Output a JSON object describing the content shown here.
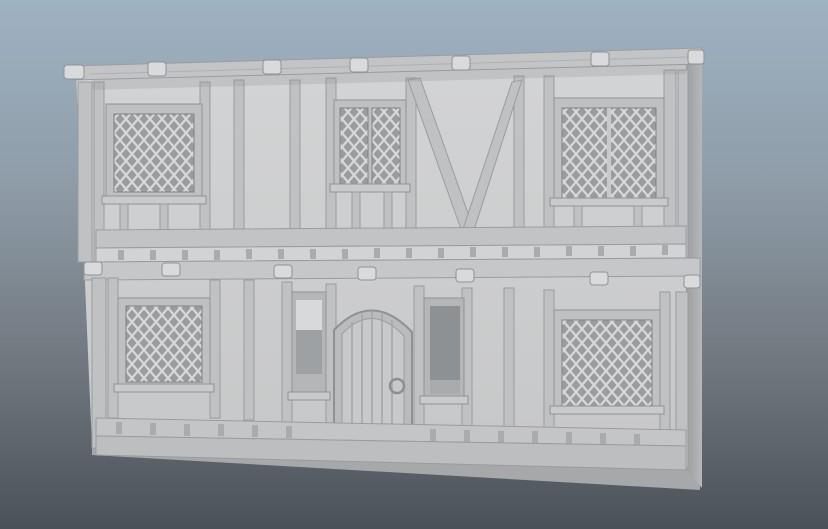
{
  "scene": {
    "subject": "",
    "colors": {
      "background_top": "#9fb2c2",
      "background_bottom": "#4b5158",
      "wall": "#cfd0d1",
      "timber": "#c2c3c4",
      "timber_dark": "#a9abad",
      "shadow": "#8e9194",
      "lattice_back": "#9a9c9e"
    }
  }
}
